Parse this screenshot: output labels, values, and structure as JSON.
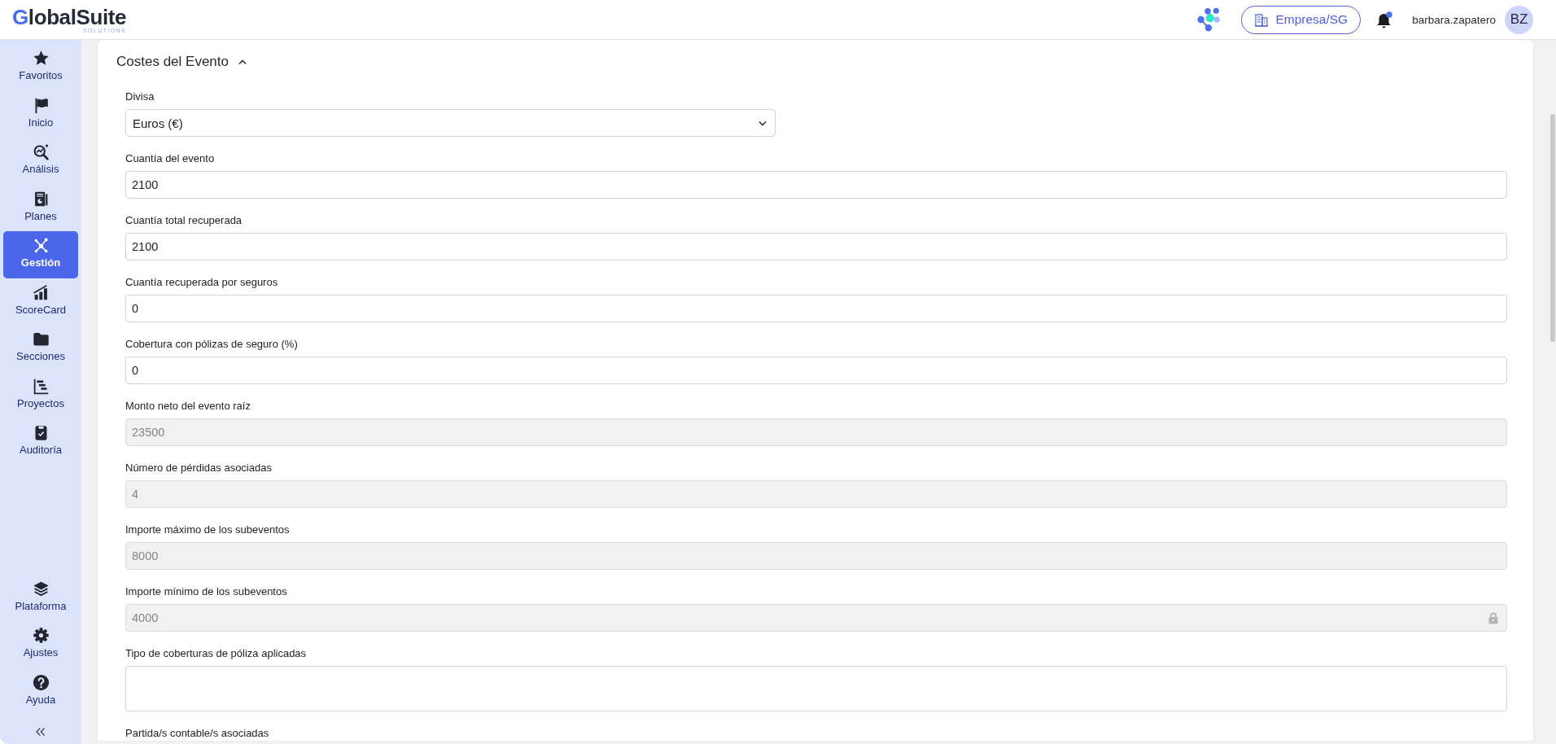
{
  "header": {
    "logo": {
      "name": "GlobalSuite",
      "tagline": "SOLUTIONS"
    },
    "company_button": "Empresa/SG",
    "notifications": {
      "unread": true
    },
    "user": {
      "name": "barbara.zapatero",
      "initials": "BZ"
    }
  },
  "sidebar": {
    "items": [
      {
        "label": "Favoritos",
        "selected": false
      },
      {
        "label": "Inicio",
        "selected": false
      },
      {
        "label": "Análisis",
        "selected": false
      },
      {
        "label": "Planes",
        "selected": false
      },
      {
        "label": "Gestión",
        "selected": true
      },
      {
        "label": "ScoreCard",
        "selected": false
      },
      {
        "label": "Secciones",
        "selected": false
      },
      {
        "label": "Proyectos",
        "selected": false
      },
      {
        "label": "Auditoría",
        "selected": false
      }
    ],
    "bottom_items": [
      {
        "label": "Plataforma",
        "selected": false
      },
      {
        "label": "Ajustes",
        "selected": false
      },
      {
        "label": "Ayuda",
        "selected": false
      }
    ]
  },
  "section": {
    "title": "Costes del Evento",
    "expanded": true,
    "fields": [
      {
        "label": "Divisa",
        "kind": "select",
        "value": "Euros (€)",
        "disabled": false,
        "locked": false
      },
      {
        "label": "Cuantía del evento",
        "kind": "input",
        "value": "2100",
        "disabled": false,
        "locked": false
      },
      {
        "label": "Cuantía total recuperada",
        "kind": "input",
        "value": "2100",
        "disabled": false,
        "locked": false
      },
      {
        "label": "Cuantía recuperada por seguros",
        "kind": "input",
        "value": "0",
        "disabled": false,
        "locked": false
      },
      {
        "label": "Cobertura con pólizas de seguro (%)",
        "kind": "input",
        "value": "0",
        "disabled": false,
        "locked": false
      },
      {
        "label": "Monto neto del evento raíz",
        "kind": "input",
        "value": "23500",
        "disabled": true,
        "locked": false
      },
      {
        "label": "Número de pérdidas asociadas",
        "kind": "input",
        "value": "4",
        "disabled": true,
        "locked": false
      },
      {
        "label": "Importe máximo de los subeventos",
        "kind": "input",
        "value": "8000",
        "disabled": true,
        "locked": false
      },
      {
        "label": "Importe mínimo de los subeventos",
        "kind": "input",
        "value": "4000",
        "disabled": true,
        "locked": true
      },
      {
        "label": "Tipo de coberturas de póliza aplicadas",
        "kind": "textarea",
        "disabled": false,
        "locked": false
      },
      {
        "label": "Partida/s contable/s asociadas",
        "kind": "label_only"
      }
    ]
  }
}
